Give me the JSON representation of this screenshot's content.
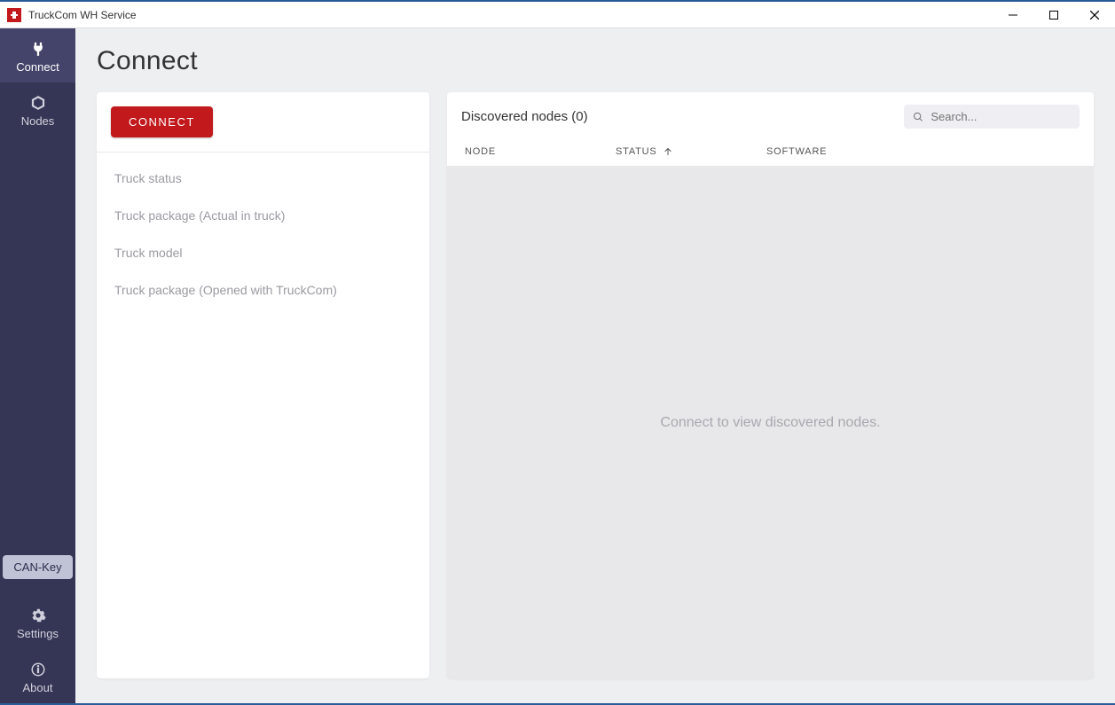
{
  "window": {
    "title": "TruckCom WH Service"
  },
  "sidebar": {
    "items": [
      {
        "id": "connect",
        "label": "Connect",
        "icon": "plug",
        "active": true
      },
      {
        "id": "nodes",
        "label": "Nodes",
        "icon": "cube",
        "active": false
      }
    ],
    "can_key_label": "CAN-Key",
    "bottom_items": [
      {
        "id": "settings",
        "label": "Settings",
        "icon": "gear"
      },
      {
        "id": "about",
        "label": "About",
        "icon": "info"
      }
    ]
  },
  "page": {
    "title": "Connect"
  },
  "left_panel": {
    "connect_button": "CONNECT",
    "info_items": [
      "Truck status",
      "Truck package (Actual in truck)",
      "Truck model",
      "Truck package (Opened with TruckCom)"
    ]
  },
  "right_panel": {
    "title_prefix": "Discovered nodes",
    "count": 0,
    "title": "Discovered nodes (0)",
    "search_placeholder": "Search...",
    "columns": {
      "node": "NODE",
      "status": "STATUS",
      "software": "SOFTWARE"
    },
    "sort": {
      "column": "status",
      "direction": "asc"
    },
    "empty_message": "Connect to view discovered nodes."
  }
}
